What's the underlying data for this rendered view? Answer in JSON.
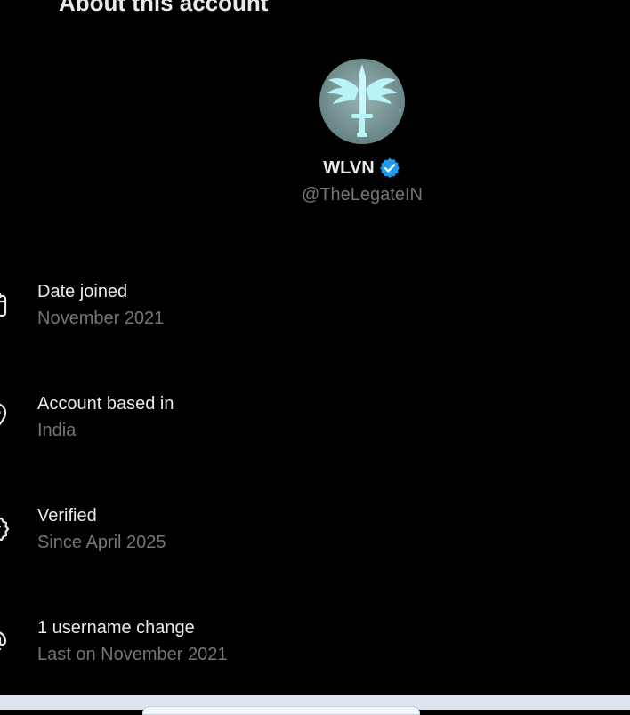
{
  "header": {
    "title": "About this account"
  },
  "profile": {
    "display_name": "WLVN",
    "handle": "@TheLegateIN",
    "verified_badge": "verified-badge-icon",
    "avatar_colors": {
      "bg": "#7f9b9b",
      "emblem": "#b8f4f7"
    }
  },
  "details": [
    {
      "icon": "calendar-icon",
      "label": "Date joined",
      "value": "November 2021"
    },
    {
      "icon": "location-pin-icon",
      "label": "Account based in",
      "value": "India"
    },
    {
      "icon": "verified-seal-icon",
      "label": "Verified",
      "value": "Since April 2025"
    },
    {
      "icon": "at-sign-icon",
      "label": "1 username change",
      "value": "Last on November 2021"
    }
  ],
  "colors": {
    "background": "#000000",
    "primary_text": "#e7e9ea",
    "secondary_text": "#71767b",
    "badge_blue": "#1d9bf0"
  }
}
